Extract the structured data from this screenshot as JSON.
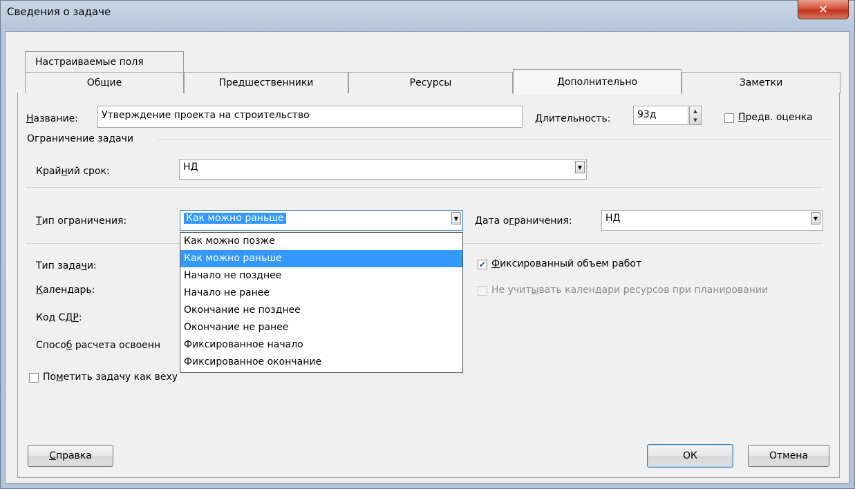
{
  "window": {
    "title": "Сведения о задаче",
    "close_glyph": "✕"
  },
  "tabs": {
    "row1": [
      {
        "label": "Настраиваемые поля"
      }
    ],
    "row2": [
      {
        "label": "Общие"
      },
      {
        "label": "Предшественники"
      },
      {
        "label": "Ресурсы"
      },
      {
        "label": "Дополнительно"
      },
      {
        "label": "Заметки"
      }
    ],
    "active": "Дополнительно"
  },
  "fields": {
    "name_label": "Название:",
    "name_value": "Утверждение проекта на строительство",
    "duration_label": "Длительность:",
    "duration_value": "93д",
    "estimate_label": "Предв. оценка",
    "constraint_group": "Ограничение задачи",
    "deadline_label": "Крайний срок:",
    "deadline_value": "НД",
    "constraint_type_label": "Тип ограничения:",
    "constraint_type_value": "Как можно раньше",
    "constraint_date_label": "Дата ограничения:",
    "constraint_date_value": "НД",
    "task_type_label": "Тип задачи:",
    "calendar_label": "Календарь:",
    "wbs_label": "Код СДР:",
    "earned_value_label": "Способ расчета освоенн",
    "effort_driven_label": "Фиксированный объем работ",
    "effort_driven_checked": true,
    "ignore_calendars_label": "Не учитывать календари ресурсов при планировании",
    "ignore_calendars_enabled": false,
    "milestone_label": "Пометить задачу как веху"
  },
  "dropdown_options": [
    "Как можно позже",
    "Как можно раньше",
    "Начало не позднее",
    "Начало не ранее",
    "Окончание не позднее",
    "Окончание не ранее",
    "Фиксированное начало",
    "Фиксированное окончание"
  ],
  "dropdown_highlighted": "Как можно раньше",
  "buttons": {
    "help": "Справка",
    "ok": "ОК",
    "cancel": "Отмена"
  },
  "colors": {
    "selection": "#3399ff",
    "close_button": "#c2341d",
    "dialog_bg": "#f0f0f0"
  }
}
